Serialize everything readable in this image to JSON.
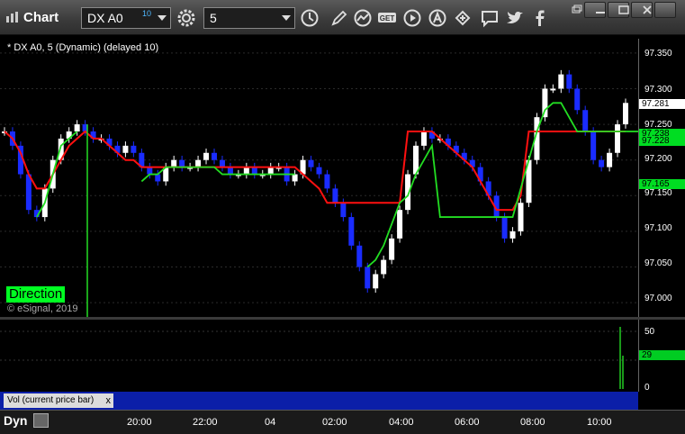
{
  "toolbar": {
    "title": "Chart",
    "symbol": "DX A0",
    "symbol_superscript": "10",
    "interval": "5",
    "icons": [
      "gear-icon",
      "clock-icon",
      "pencil-icon",
      "indicator-icon",
      "get-icon",
      "play-icon",
      "alert-icon",
      "link-icon",
      "comment-icon",
      "twitter-icon",
      "facebook-icon"
    ]
  },
  "chart": {
    "study_label": "* DX A0, 5 (Dynamic) (delayed 10)",
    "direction_badge": "Direction",
    "copyright": "© eSignal, 2019",
    "price_axis": [
      "97.350",
      "97.300",
      "97.250",
      "97.200",
      "97.150",
      "97.100",
      "97.050",
      "97.000"
    ],
    "price_tags": [
      {
        "value": "97.281",
        "color": "#ffffff"
      },
      {
        "value": "97.238",
        "color": "#00dd22"
      },
      {
        "value": "97.228",
        "color": "#00dd22"
      },
      {
        "value": "97.165",
        "color": "#00dd22"
      }
    ],
    "volume_axis": [
      "50",
      "25",
      "0"
    ],
    "volume_tag": {
      "value": "29",
      "color": "#00cc22"
    },
    "volume_legend": "Vol (current price bar)",
    "volume_legend_close": "x",
    "time_axis": [
      "20:00",
      "22:00",
      "04",
      "02:00",
      "04:00",
      "06:00",
      "08:00",
      "10:00"
    ],
    "pane_name": "Dyn"
  },
  "colors": {
    "bull": "#ffffff",
    "bear": "#1a2cff",
    "trend_red": "#ff1010",
    "trend_green": "#22dd22",
    "background": "#000000"
  },
  "chart_data": {
    "type": "line",
    "ylim": [
      96.98,
      97.37
    ],
    "yticks": [
      97.0,
      97.05,
      97.1,
      97.15,
      97.2,
      97.25,
      97.3,
      97.35
    ],
    "close": [
      97.24,
      97.22,
      97.18,
      97.13,
      97.12,
      97.16,
      97.2,
      97.23,
      97.24,
      97.25,
      97.24,
      97.23,
      97.23,
      97.22,
      97.21,
      97.22,
      97.21,
      97.19,
      97.18,
      97.17,
      97.19,
      97.2,
      97.19,
      97.19,
      97.2,
      97.21,
      97.2,
      97.19,
      97.18,
      97.18,
      97.19,
      97.18,
      97.18,
      97.19,
      97.19,
      97.17,
      97.18,
      97.2,
      97.19,
      97.18,
      97.16,
      97.14,
      97.12,
      97.08,
      97.05,
      97.02,
      97.04,
      97.06,
      97.09,
      97.13,
      97.18,
      97.22,
      97.24,
      97.23,
      97.23,
      97.22,
      97.21,
      97.2,
      97.19,
      97.17,
      97.15,
      97.12,
      97.09,
      97.1,
      97.14,
      97.2,
      97.26,
      97.3,
      97.3,
      97.32,
      97.3,
      97.27,
      97.24,
      97.2,
      97.19,
      97.21,
      97.25,
      97.28
    ],
    "red_trend": [
      97.24,
      97.23,
      97.21,
      97.18,
      97.16,
      97.16,
      97.18,
      97.2,
      97.22,
      97.23,
      97.24,
      97.23,
      97.23,
      97.22,
      97.21,
      97.2,
      97.2,
      97.19,
      97.19,
      97.19,
      97.19,
      97.19,
      97.19,
      97.19,
      97.19,
      97.19,
      97.19,
      97.19,
      97.19,
      97.19,
      97.19,
      97.19,
      97.19,
      97.19,
      97.19,
      97.19,
      97.19,
      97.18,
      97.17,
      97.16,
      97.14,
      97.14,
      97.14,
      97.14,
      97.14,
      97.14,
      97.14,
      97.14,
      97.14,
      97.14,
      97.24,
      97.24,
      97.24,
      97.24,
      97.23,
      97.22,
      97.21,
      97.2,
      97.19,
      97.17,
      97.15,
      97.13,
      97.13,
      97.13,
      97.15,
      97.24,
      97.24,
      97.24,
      97.24,
      97.24,
      97.24,
      97.24,
      97.24,
      97.24,
      97.24,
      97.24,
      97.24,
      97.24
    ],
    "green_trend": [
      null,
      null,
      null,
      null,
      97.12,
      97.14,
      97.18,
      97.22,
      97.23,
      97.24,
      null,
      null,
      null,
      null,
      null,
      null,
      null,
      97.17,
      97.18,
      97.18,
      97.19,
      97.19,
      97.19,
      97.19,
      97.19,
      97.19,
      97.19,
      97.18,
      97.18,
      97.18,
      97.18,
      97.18,
      97.18,
      97.18,
      97.18,
      97.18,
      97.18,
      null,
      null,
      null,
      null,
      null,
      null,
      null,
      null,
      97.05,
      97.06,
      97.08,
      97.11,
      97.14,
      97.15,
      97.18,
      97.2,
      97.22,
      97.12,
      97.12,
      97.12,
      97.12,
      97.12,
      97.12,
      97.12,
      97.12,
      97.12,
      97.12,
      97.16,
      97.2,
      97.24,
      97.27,
      97.28,
      97.28,
      97.26,
      97.24,
      97.24,
      97.24,
      97.24,
      97.24,
      97.24,
      97.24
    ],
    "volume": {
      "values_tail": [
        52,
        20,
        29
      ],
      "ylim": [
        0,
        55
      ]
    }
  }
}
